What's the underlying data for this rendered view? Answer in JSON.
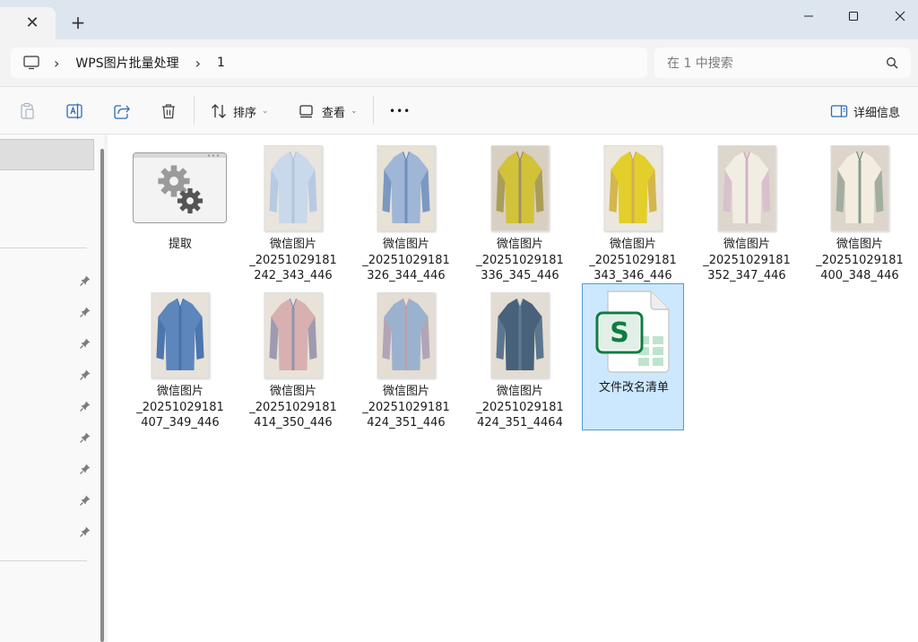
{
  "window": {
    "tab_close_glyph": "✕",
    "new_tab_glyph": "+"
  },
  "address": {
    "crumbs": [
      "WPS图片批量处理",
      "1"
    ],
    "separator": "›"
  },
  "search": {
    "placeholder": "在 1 中搜索"
  },
  "commands": {
    "sort_label": "排序",
    "view_label": "查看",
    "more_label": "•••",
    "details_label": "详细信息"
  },
  "files": [
    {
      "name": "提取",
      "kind": "exe"
    },
    {
      "name": "微信图片\n_20251029181\n242_343_446",
      "kind": "photo",
      "colors": [
        "#c9d8ea",
        "#a7bfdc",
        "#e9e4dd"
      ]
    },
    {
      "name": "微信图片\n_20251029181\n326_344_446",
      "kind": "photo",
      "colors": [
        "#9fb6d6",
        "#5d7fb4",
        "#e7e1d6"
      ]
    },
    {
      "name": "微信图片\n_20251029181\n336_345_446",
      "kind": "photo",
      "colors": [
        "#d1c23a",
        "#8a7f72",
        "#d9cfc1"
      ]
    },
    {
      "name": "微信图片\n_20251029181\n343_346_446",
      "kind": "photo",
      "colors": [
        "#e2cf2c",
        "#c9a36a",
        "#ece7dd"
      ]
    },
    {
      "name": "微信图片\n_20251029181\n352_347_446",
      "kind": "photo",
      "colors": [
        "#f2ede2",
        "#c49bbb",
        "#ddd6cc"
      ]
    },
    {
      "name": "微信图片\n_20251029181\n400_348_446",
      "kind": "photo",
      "colors": [
        "#f3ede0",
        "#5c7a6c",
        "#ddd5ca"
      ]
    },
    {
      "name": "微信图片\n_20251029181\n407_349_446",
      "kind": "photo",
      "colors": [
        "#5d86bd",
        "#3f6aa3",
        "#e6e1d9"
      ]
    },
    {
      "name": "微信图片\n_20251029181\n414_350_446",
      "kind": "photo",
      "colors": [
        "#d8b0b0",
        "#6f8ab2",
        "#e9e2d9"
      ]
    },
    {
      "name": "微信图片\n_20251029181\n424_351_446",
      "kind": "photo",
      "colors": [
        "#9bb2cf",
        "#c79aa4",
        "#e4ddd4"
      ]
    },
    {
      "name": "微信图片\n_20251029181\n424_351_4464",
      "kind": "photo",
      "colors": [
        "#48627b",
        "#6d86a0",
        "#e2dcd2"
      ]
    },
    {
      "name": "文件改名清单",
      "kind": "sheet"
    }
  ],
  "selected_file": "文件改名清单",
  "accent": "#107c41"
}
